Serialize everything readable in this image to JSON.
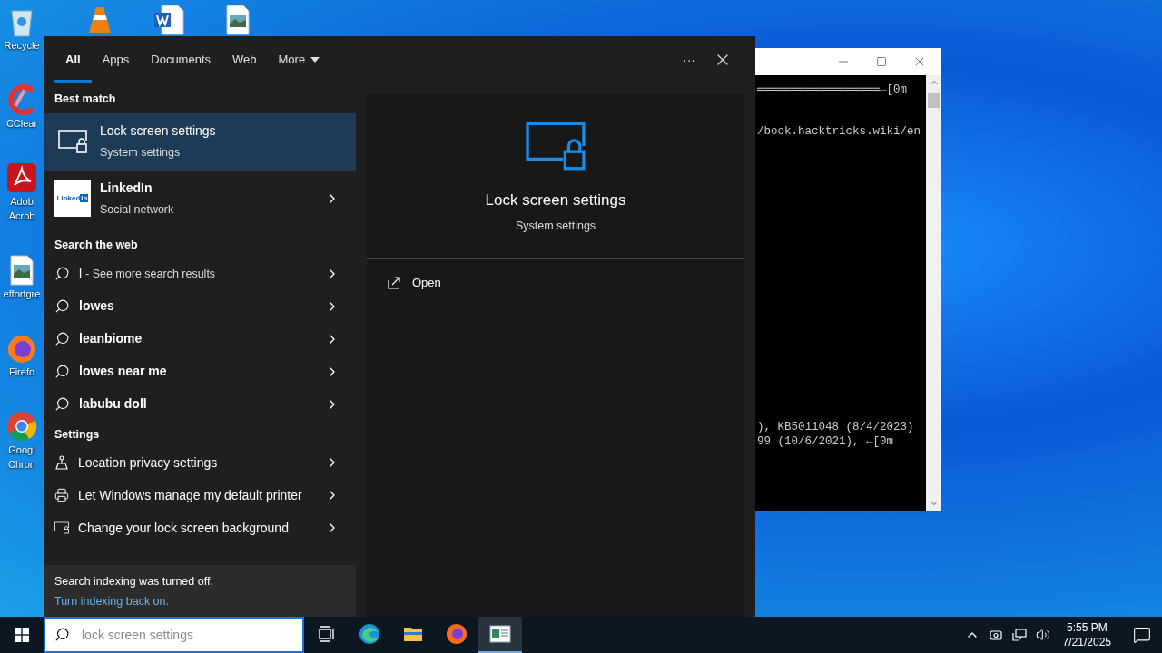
{
  "desktop_icons": [
    {
      "kind": "recycle",
      "lines": [
        "Recycle"
      ]
    },
    {
      "kind": "ccleaner",
      "lines": [
        "CClear"
      ]
    },
    {
      "kind": "acrobat",
      "lines": [
        "Adob",
        "Acrob"
      ]
    },
    {
      "kind": "image",
      "lines": [
        "effortgre"
      ]
    },
    {
      "kind": "firefox",
      "lines": [
        "Firefo"
      ]
    },
    {
      "kind": "chrome",
      "lines": [
        "Googl",
        "Chron"
      ]
    },
    {
      "kind": "vlc"
    },
    {
      "kind": "word"
    },
    {
      "kind": "image"
    }
  ],
  "terminal": {
    "top_lines": [
      "══════════════════←[0m"
    ],
    "middle_lines": [
      "/book.hacktricks.wiki/en"
    ],
    "bottom_lines": [
      "), KB5011048 (8/4/2023)",
      "99 (10/6/2021), ←[0m"
    ]
  },
  "search": {
    "tabs": [
      {
        "label": "All",
        "selected": true
      },
      {
        "label": "Apps",
        "selected": false
      },
      {
        "label": "Documents",
        "selected": false
      },
      {
        "label": "Web",
        "selected": false
      }
    ],
    "more_tab": {
      "label": "More"
    },
    "options_glyph": "···",
    "best_match": {
      "heading": "Best match",
      "items": [
        {
          "kind": "lockscreen",
          "title": "Lock screen settings",
          "subtitle": "System settings",
          "selected": true
        },
        {
          "kind": "linkedin",
          "title": "LinkedIn",
          "subtitle": "Social network",
          "selected": false,
          "logo": "Linked",
          "logo_box": "in"
        }
      ]
    },
    "web": {
      "heading": "Search the web",
      "items": [
        {
          "kind": "more",
          "query": "l",
          "text": "- See more search results"
        },
        {
          "kind": "suggestion",
          "text": "lowes"
        },
        {
          "kind": "suggestion",
          "text": "leanbiome"
        },
        {
          "kind": "suggestion",
          "text": "lowes near me"
        },
        {
          "kind": "suggestion",
          "text": "labubu doll"
        }
      ]
    },
    "settings": {
      "heading": "Settings",
      "items": [
        {
          "kind": "location",
          "text": "Location privacy settings"
        },
        {
          "kind": "printer",
          "text": "Let Windows manage my default printer"
        },
        {
          "kind": "lockscreen",
          "text": "Change your lock screen background"
        }
      ]
    },
    "notice": {
      "text": "Search indexing was turned off.",
      "link": "Turn indexing back on."
    },
    "preview": {
      "title": "Lock screen settings",
      "subtitle": "System settings",
      "actions": [
        {
          "label": "Open"
        }
      ]
    }
  },
  "taskbar": {
    "search": {
      "placeholder": "lock screen settings"
    },
    "apps": [
      {
        "kind": "taskview",
        "active": false
      },
      {
        "kind": "edge",
        "active": false
      },
      {
        "kind": "explorer",
        "active": false
      },
      {
        "kind": "firefox",
        "active": false
      },
      {
        "kind": "window",
        "active": true
      }
    ],
    "time": "5:55 PM",
    "date": "7/21/2025"
  }
}
